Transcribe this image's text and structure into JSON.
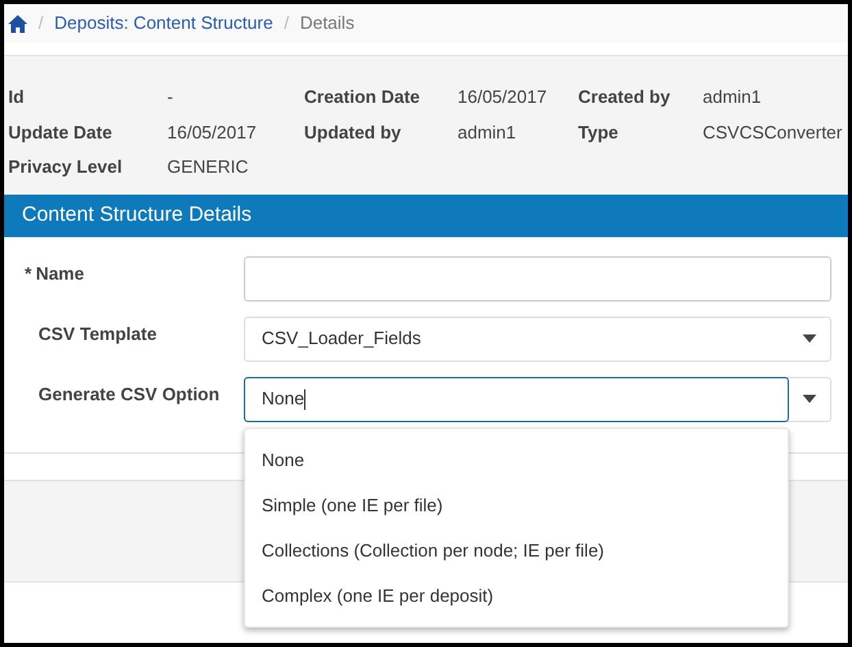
{
  "breadcrumb": {
    "links": [
      {
        "separator": "/",
        "label": "Deposits: Content Structure"
      }
    ],
    "current_separator": "/",
    "current": "Details"
  },
  "metadata": [
    {
      "label": "Id",
      "value": "-"
    },
    {
      "label": "Creation Date",
      "value": "16/05/2017"
    },
    {
      "label": "Created by",
      "value": "admin1"
    },
    {
      "label": "Update Date",
      "value": "16/05/2017"
    },
    {
      "label": "Updated by",
      "value": "admin1"
    },
    {
      "label": "Type",
      "value": "CSVCSConverter"
    },
    {
      "label": "Privacy Level",
      "value": "GENERIC"
    }
  ],
  "section": {
    "title": "Content Structure Details"
  },
  "form": [
    {
      "kind": "text",
      "required_mark": "*",
      "label": "Name",
      "focused": false
    },
    {
      "kind": "select",
      "label": "CSV Template",
      "value": "CSV_Loader_Fields",
      "focused": false
    },
    {
      "kind": "select",
      "label": "Generate CSV Option",
      "value": "None",
      "focused": true
    }
  ],
  "dropdown": {
    "options": [
      "None",
      "Simple (one IE per file)",
      "Collections (Collection per node; IE per file)",
      "Complex (one IE per deposit)"
    ]
  }
}
